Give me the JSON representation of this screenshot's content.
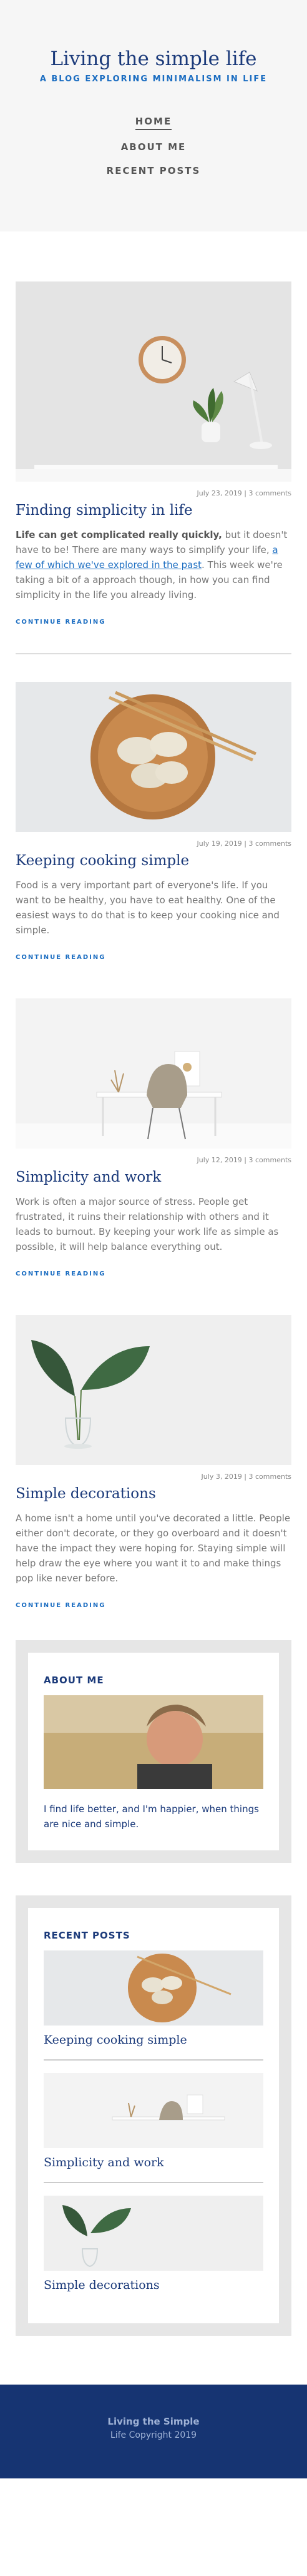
{
  "header": {
    "title": "Living the simple life",
    "tagline": "A BLOG EXPLORING MINIMALISM IN LIFE",
    "nav": [
      "HOME",
      "ABOUT ME",
      "RECENT POSTS"
    ]
  },
  "posts": [
    {
      "meta": "July 23, 2019 | 3 comments",
      "title": "Finding simplicity in life",
      "excerpt_bold": "Life can get complicated really quickly,",
      "excerpt_1": " but it doesn't have to be! There are many ways to simplify your life, ",
      "excerpt_link": "a few of which we've explored in the past",
      "excerpt_2": ". This week we're taking a bit of a approach though, in how you can find simplicity in the life you already living.",
      "more": "CONTINUE READING"
    },
    {
      "meta": "July 19, 2019 | 3 comments",
      "title": "Keeping cooking simple",
      "excerpt": "Food is a very important part of everyone's life. If you want to be healthy, you have to eat healthy. One of the easiest ways to do that is to keep your cooking nice and simple.",
      "more": "CONTINUE READING"
    },
    {
      "meta": "July 12, 2019 | 3 comments",
      "title": "Simplicity and work",
      "excerpt": "Work is often a major source of stress. People get frustrated, it ruins their relationship with others and it leads to burnout. By keeping your work life as simple as possible, it will help balance everything out.",
      "more": "CONTINUE READING"
    },
    {
      "meta": "July 3, 2019 | 3 comments",
      "title": "Simple decorations",
      "excerpt": "A home isn't a home until you've decorated a little. People either don't decorate, or they go overboard and it doesn't have the impact they were hoping for. Staying simple will help draw the eye where you want it to and make things pop like never before.",
      "more": "CONTINUE READING"
    }
  ],
  "about": {
    "title": "ABOUT ME",
    "text": "I find life better, and I'm happier, when things are nice and simple."
  },
  "recent": {
    "title": "RECENT POSTS",
    "items": [
      "Keeping cooking simple",
      "Simplicity and work",
      "Simple decorations"
    ]
  },
  "footer": {
    "line1": "Living the Simple",
    "line2": "Life Copyright 2019"
  },
  "colors": {
    "brand": "#1b3a7a",
    "accent": "#1b6dc1",
    "footer_bg": "#163472"
  }
}
